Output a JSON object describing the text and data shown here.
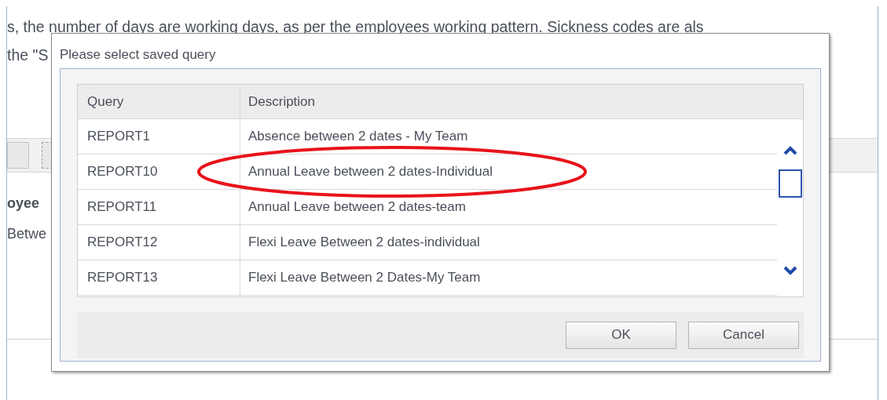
{
  "background": {
    "lines": [
      "s, the number of days are working days, as per the employees working pattern. Sickness codes are als",
      "the \"S"
    ],
    "labels": [
      "oyee",
      "Betwe"
    ]
  },
  "dialog": {
    "title": "Please select saved query",
    "table": {
      "columns": [
        "Query",
        "Description"
      ],
      "rows": [
        {
          "cells": [
            "REPORT1",
            "Absence between 2 dates - My Team"
          ],
          "circled": false
        },
        {
          "cells": [
            "REPORT10",
            "Annual Leave between 2 dates-Individual"
          ],
          "circled": true
        },
        {
          "cells": [
            "REPORT11",
            "Annual Leave between 2 dates-team"
          ],
          "circled": false
        },
        {
          "cells": [
            "REPORT12",
            "Flexi Leave Between 2 dates-individual"
          ],
          "circled": false
        },
        {
          "cells": [
            "REPORT13",
            "Flexi Leave Between 2 Dates-My Team"
          ],
          "circled": false
        }
      ]
    },
    "buttons": [
      "OK",
      "Cancel"
    ]
  }
}
